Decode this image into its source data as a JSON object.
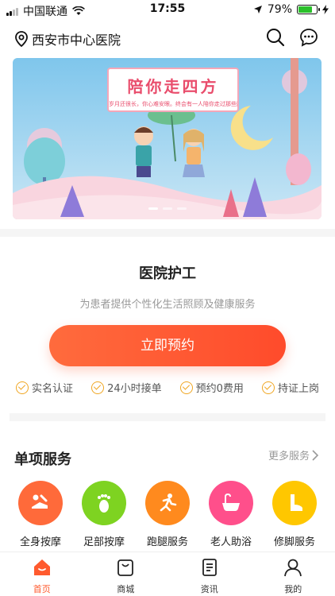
{
  "status_bar": {
    "carrier": "中国联通",
    "time": "17:55",
    "battery_percent": "79%",
    "battery_level": 0.79
  },
  "header": {
    "location": "西安市中心医院",
    "icons": [
      "location-pin-icon",
      "search-icon",
      "message-icon"
    ]
  },
  "banner": {
    "title": "陪你走四方",
    "subtitle": "岁月还很长，你心难安眼。终会有一人陪你走过那些路"
  },
  "care": {
    "title": "医院护工",
    "subtitle": "为患者提供个性化生活照顾及健康服务",
    "book_label": "立即预约",
    "features": [
      "实名认证",
      "24小时接单",
      "预约0费用",
      "持证上岗"
    ]
  },
  "services": {
    "title": "单项服务",
    "more_label": "更多服务",
    "items": [
      {
        "label": "全身按摩",
        "color": "#ff6a3a",
        "icon": "massage-icon"
      },
      {
        "label": "足部按摩",
        "color": "#7ed321",
        "icon": "footprint-icon"
      },
      {
        "label": "跑腿服务",
        "color": "#ff8a1e",
        "icon": "runner-icon"
      },
      {
        "label": "老人助浴",
        "color": "#ff4f8b",
        "icon": "bathtub-icon"
      },
      {
        "label": "修脚服务",
        "color": "#ffc700",
        "icon": "foot-icon"
      }
    ]
  },
  "tabs": [
    {
      "label": "首页",
      "icon": "home-icon",
      "active": true
    },
    {
      "label": "商城",
      "icon": "shopping-bag-icon",
      "active": false
    },
    {
      "label": "资讯",
      "icon": "news-icon",
      "active": false
    },
    {
      "label": "我的",
      "icon": "user-icon",
      "active": false
    }
  ],
  "colors": {
    "accent": "#ff5a2e",
    "check": "#f0a623"
  }
}
